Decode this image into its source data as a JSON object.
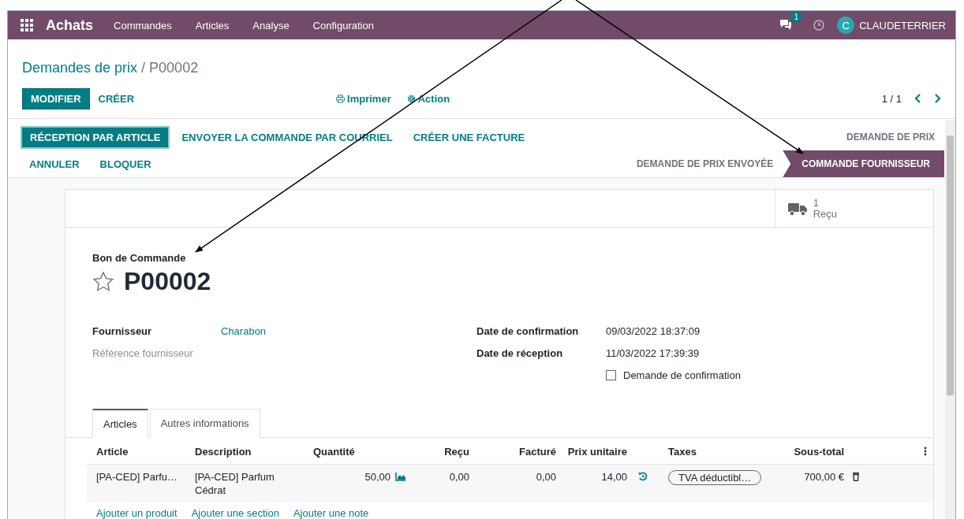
{
  "navbar": {
    "app": "Achats",
    "menus": [
      "Commandes",
      "Articles",
      "Analyse",
      "Configuration"
    ],
    "chat_badge": "1",
    "user_initial": "C",
    "user": "CLAUDETERRIER"
  },
  "breadcrumb": {
    "parent": "Demandes de prix",
    "separator": "/",
    "current": "P00002"
  },
  "control_panel": {
    "buttons": [
      {
        "label": "MODIFIER",
        "primary": true
      },
      {
        "label": "CRÉER",
        "primary": false
      }
    ],
    "actions": [
      {
        "kind": "print",
        "label": "Imprimer"
      },
      {
        "kind": "gear",
        "label": "Action"
      }
    ],
    "pager": "1 / 1"
  },
  "status_rows": [
    {
      "buttons": [
        {
          "label": "RÉCEPTION PAR ARTICLE",
          "primary": true
        },
        {
          "label": "ENVOYER LA COMMANDE PAR COURRIEL",
          "primary": false
        },
        {
          "label": "CRÉER UNE FACTURE",
          "primary": false
        }
      ],
      "stages": [
        {
          "label": "DEMANDE DE PRIX",
          "selected": false
        }
      ]
    },
    {
      "buttons": [
        {
          "label": "ANNULER",
          "primary": false
        },
        {
          "label": "BLOQUER",
          "primary": false
        }
      ],
      "stages": [
        {
          "label": "DEMANDE DE PRIX ENVOYÉE",
          "selected": false
        },
        {
          "label": "COMMANDE FOURNISSEUR",
          "selected": true
        }
      ]
    }
  ],
  "smart_buttons": [
    {
      "value": "1",
      "label": "Reçu"
    }
  ],
  "form": {
    "subtitle": "Bon de Commande",
    "name": "P00002",
    "starred": false,
    "left_fields": [
      {
        "label": "Fournisseur",
        "value": "Charabon",
        "kind": "link"
      },
      {
        "label": "Référence fournisseur",
        "kind": "empty"
      }
    ],
    "right_fields": [
      {
        "label": "Date de confirmation",
        "value": "09/03/2022 18:37:09",
        "kind": "text"
      },
      {
        "label": "Date de réception",
        "value": "11/03/2022 17:39:39",
        "kind": "text"
      }
    ],
    "checkbox": {
      "label": "Demande de confirmation",
      "checked": false
    }
  },
  "tabs": [
    {
      "label": "Articles",
      "selected": true
    },
    {
      "label": "Autres informations",
      "selected": false
    }
  ],
  "table": {
    "columns": [
      "Article",
      "Description",
      "Quantité",
      "Reçu",
      "Facturé",
      "Prix unitaire",
      "Taxes",
      "Sous-total"
    ],
    "rows": [
      {
        "article": "[PA-CED] Parfu…",
        "description": "[PA-CED] Parfum Cédrat",
        "quantity": "50,00",
        "received": "0,00",
        "invoiced": "0,00",
        "unit_price": "14,00",
        "taxes": [
          "TVA déductibl…"
        ],
        "subtotal": "700,00 €"
      }
    ],
    "add_links": [
      "Ajouter un produit",
      "Ajouter une section",
      "Ajouter une note"
    ]
  }
}
